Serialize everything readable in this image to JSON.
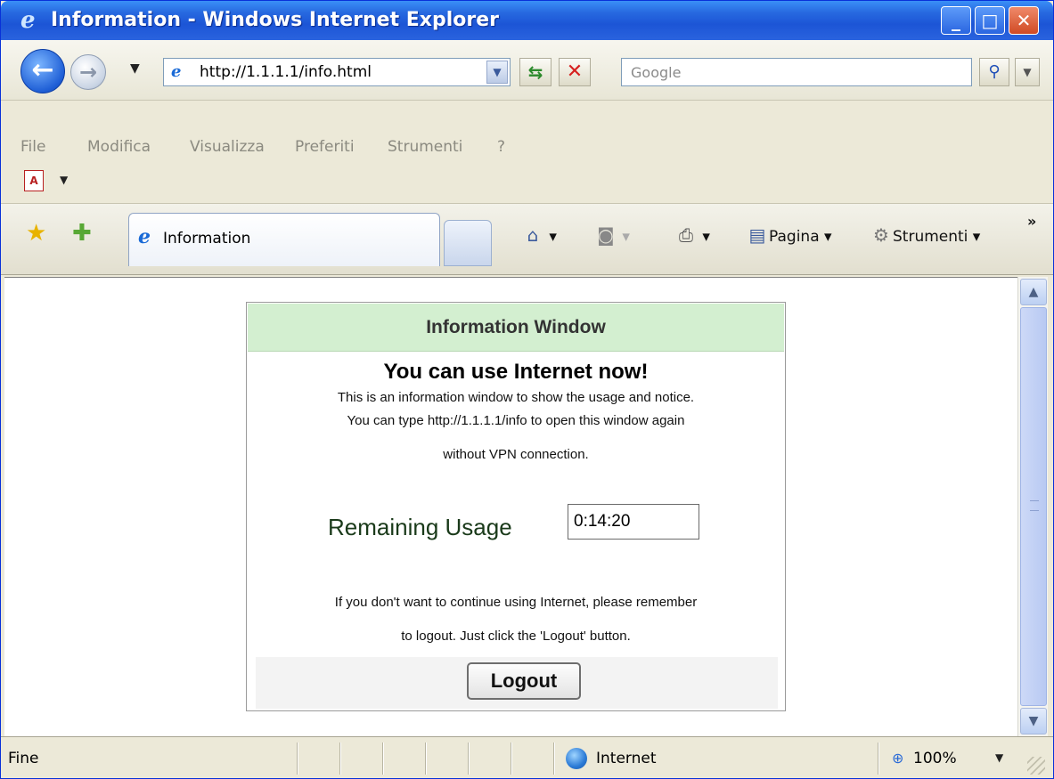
{
  "window": {
    "title": "Information - Windows Internet Explorer",
    "minimize_glyph": "_",
    "maximize_glyph": "□",
    "close_glyph": "✕"
  },
  "navbar": {
    "back_glyph": "←",
    "forward_glyph": "→",
    "address": "http://1.1.1.1/info.html",
    "search_placeholder": "Google",
    "icons": [
      "back-icon",
      "forward-icon",
      "ie-page-icon",
      "refresh-icon",
      "stop-icon",
      "search-icon"
    ]
  },
  "menubar": {
    "items": [
      "File",
      "Modifica",
      "Visualizza",
      "Preferiti",
      "Strumenti",
      "?"
    ]
  },
  "tabbar": {
    "tab_label": "Information",
    "commands": {
      "pagina": "Pagina",
      "strumenti": "Strumenti"
    },
    "icons": [
      "favorites-star-icon",
      "add-favorites-icon",
      "home-icon",
      "feeds-icon",
      "print-icon",
      "page-icon",
      "tools-gear-icon"
    ]
  },
  "page": {
    "header": "Information Window",
    "headline": "You can use Internet now!",
    "line1": "This is an information window to show the usage and notice.",
    "line2": "You can type http://1.1.1.1/info to open this window again",
    "line3": "without VPN connection.",
    "usage_label": "Remaining Usage",
    "usage_value": "0:14:20",
    "notice1": "If you don't want to continue using Internet, please remember",
    "notice2": "to logout. Just click the 'Logout' button.",
    "logout_label": "Logout"
  },
  "statusbar": {
    "status": "Fine",
    "zone": "Internet",
    "zoom": "100%"
  },
  "colors": {
    "titlebar": "#2769e0",
    "info_header_bg": "#d3efd0",
    "page_bg": "#ffffff",
    "chrome_bg": "#ece9d8"
  }
}
